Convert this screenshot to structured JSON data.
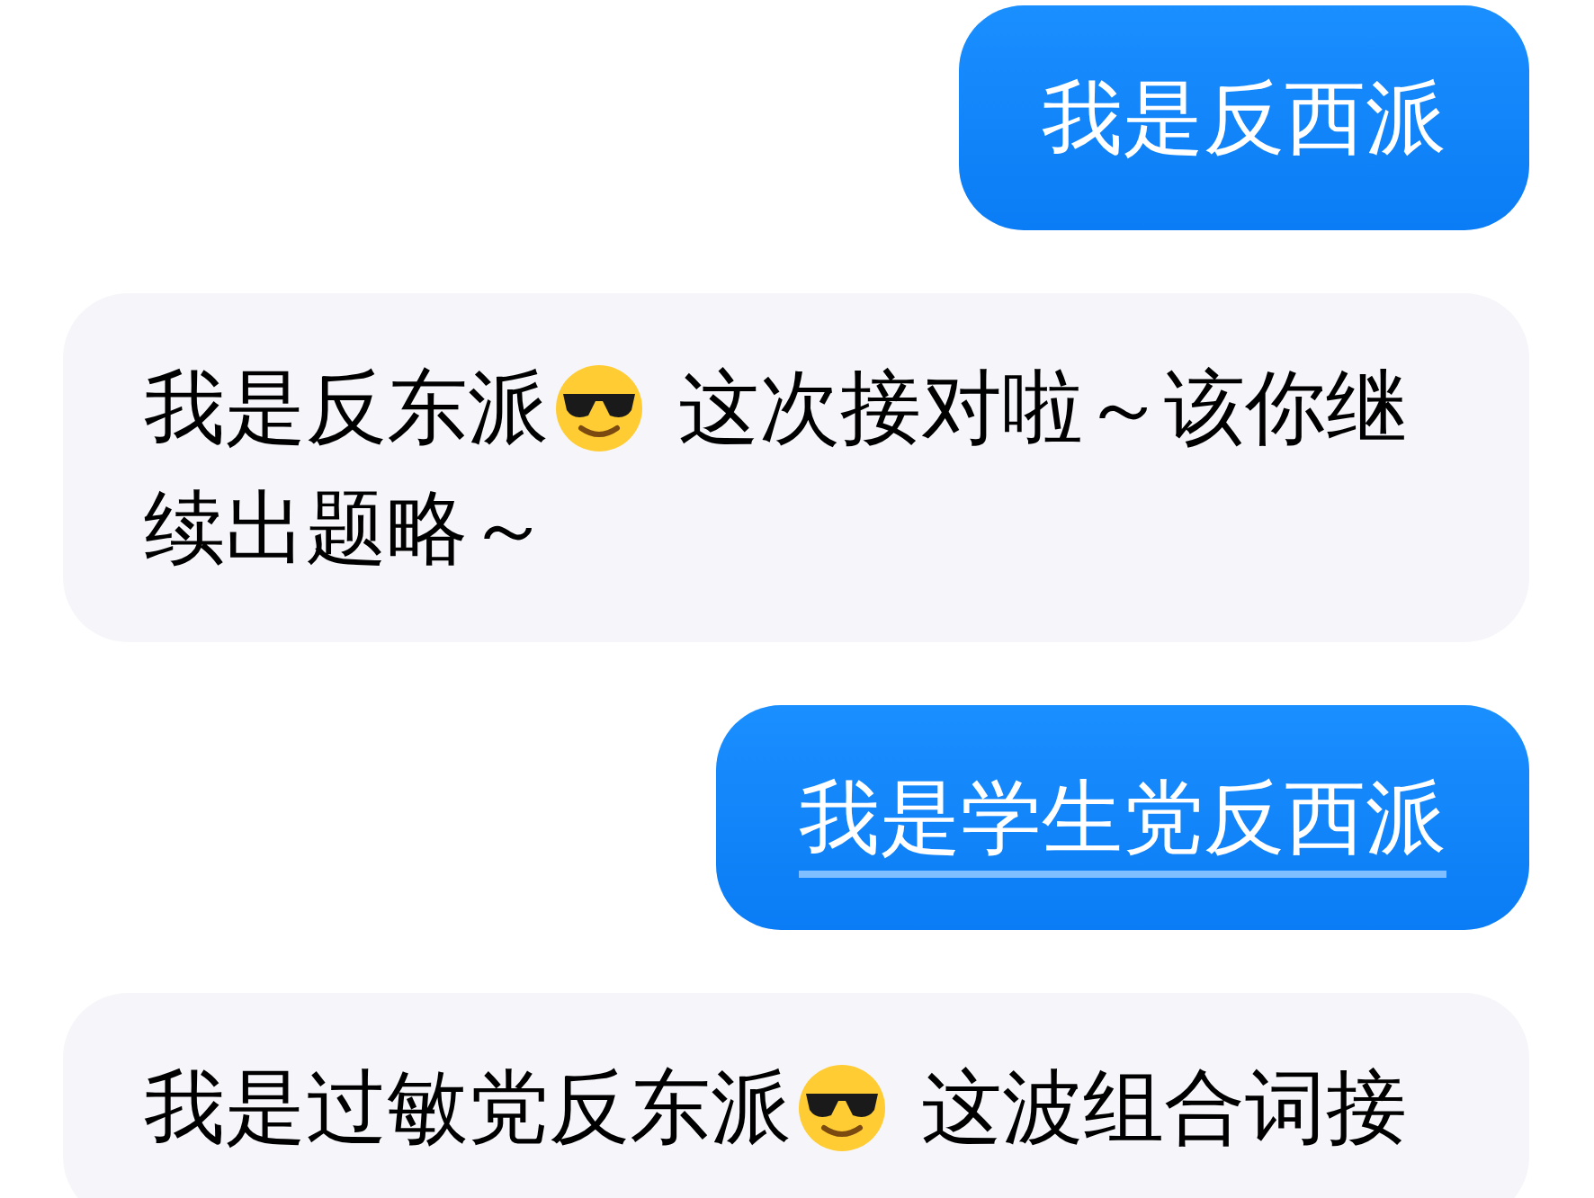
{
  "messages": [
    {
      "kind": "outgoing",
      "lines": [
        [
          {
            "kind": "text",
            "text": "我是反西派"
          }
        ]
      ]
    },
    {
      "kind": "incoming",
      "lines": [
        [
          {
            "kind": "text",
            "text": "我是反东派"
          },
          {
            "kind": "emoji"
          },
          {
            "kind": "text",
            "text": "这次接对啦～该你继"
          }
        ],
        [
          {
            "kind": "text",
            "text": "续出题略～"
          }
        ]
      ]
    },
    {
      "kind": "outgoing",
      "underlined": true,
      "lines": [
        [
          {
            "kind": "text",
            "text": "我是学生党反西派"
          }
        ]
      ]
    },
    {
      "kind": "incoming",
      "lines": [
        [
          {
            "kind": "text",
            "text": "我是过敏党反东派"
          },
          {
            "kind": "emoji"
          },
          {
            "kind": "text",
            "text": "这波组合词接"
          }
        ]
      ]
    }
  ]
}
